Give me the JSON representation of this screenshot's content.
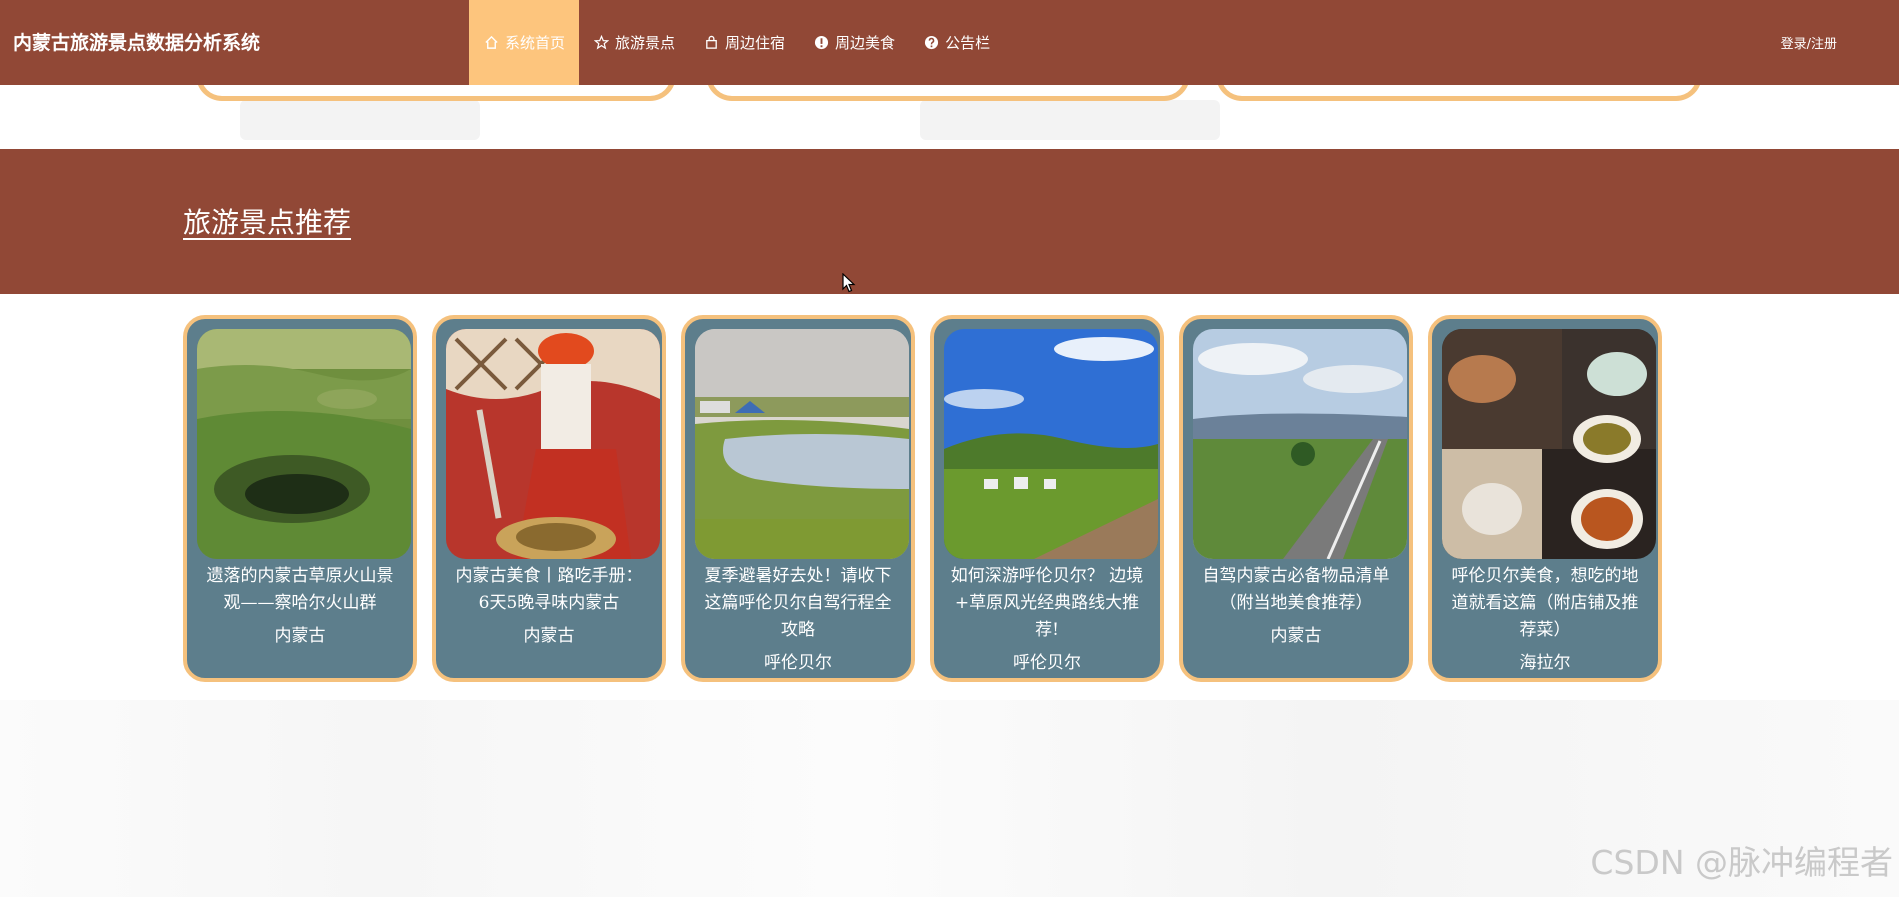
{
  "header": {
    "title": "内蒙古旅游景点数据分析系统",
    "nav": [
      {
        "label": "系统首页",
        "icon": "home-icon"
      },
      {
        "label": "旅游景点",
        "icon": "star-icon"
      },
      {
        "label": "周边住宿",
        "icon": "bag-icon"
      },
      {
        "label": "周边美食",
        "icon": "info-icon"
      },
      {
        "label": "公告栏",
        "icon": "help-icon"
      }
    ],
    "login": "登录/注册"
  },
  "section": {
    "title": "旅游景点推荐"
  },
  "cards": [
    {
      "title": "遗落的内蒙古草原火山景观——察哈尔火山群",
      "location": "内蒙古"
    },
    {
      "title": "内蒙古美食丨路吃手册：6天5晚寻味内蒙古",
      "location": "内蒙古"
    },
    {
      "title": "夏季避暑好去处！请收下这篇呼伦贝尔自驾行程全攻略",
      "location": "呼伦贝尔"
    },
    {
      "title": "如何深游呼伦贝尔？ 边境+草原风光经典路线大推荐!",
      "location": "呼伦贝尔"
    },
    {
      "title": "自驾内蒙古必备物品清单（附当地美食推荐）",
      "location": "内蒙古"
    },
    {
      "title": "呼伦贝尔美食，想吃的地道就看这篇（附店铺及推荐菜）",
      "location": "海拉尔"
    }
  ],
  "watermark": "CSDN @脉冲编程者",
  "colors": {
    "header": "#914836",
    "active_nav": "#fdc57d",
    "card_bg": "#5d7e8c",
    "card_border": "#f5c17d"
  }
}
